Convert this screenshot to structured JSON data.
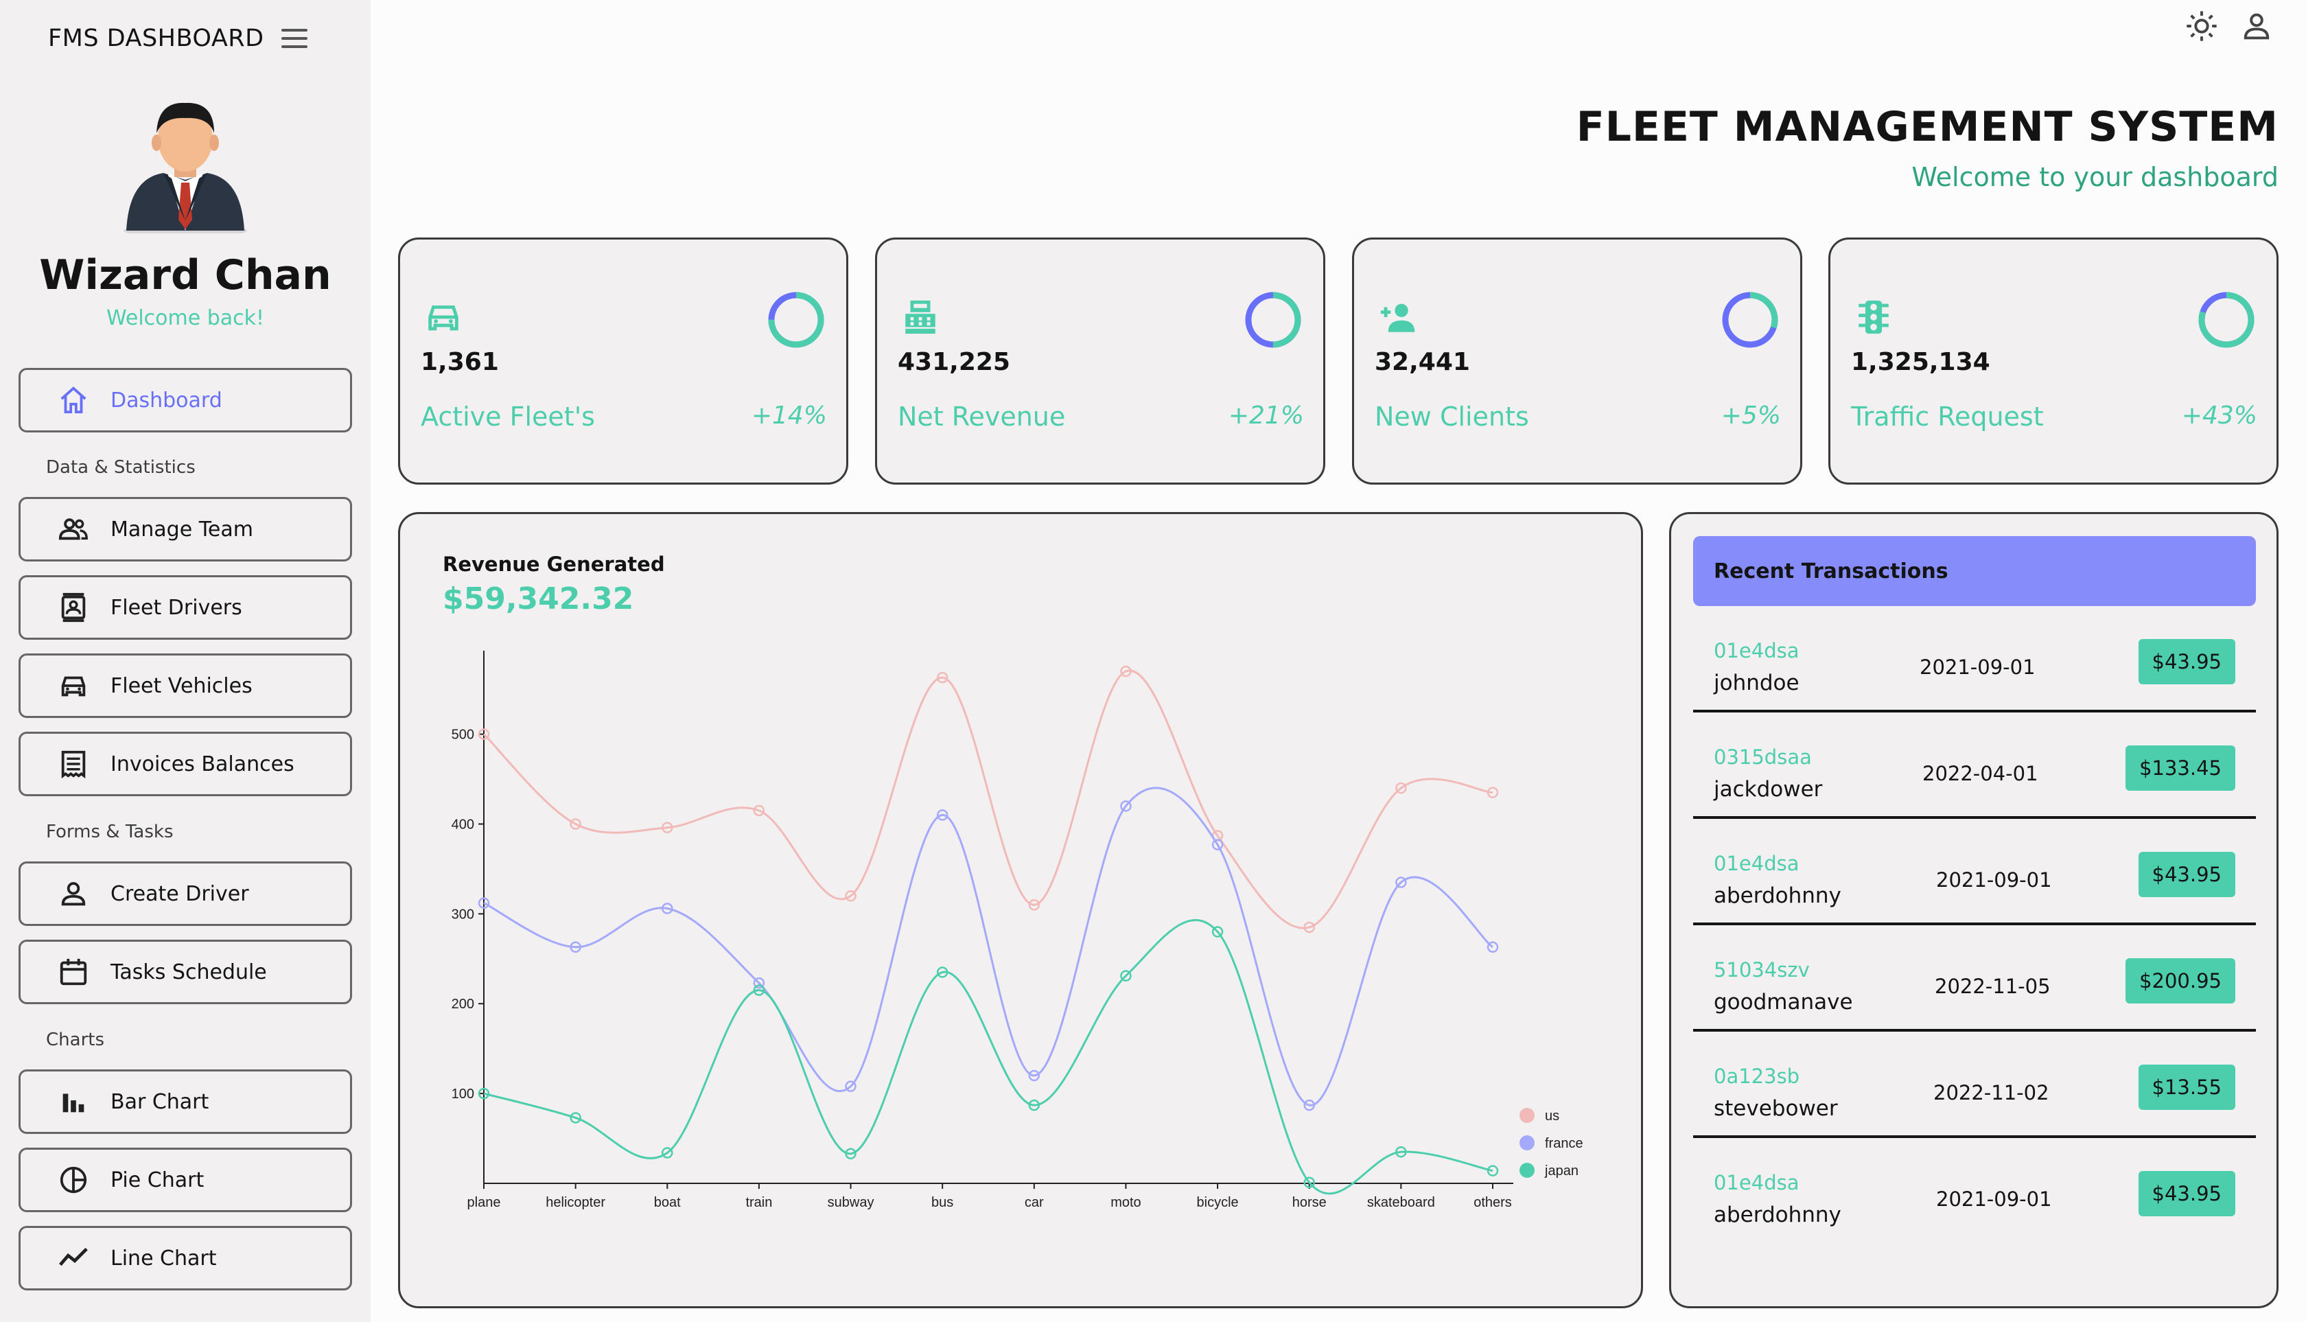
{
  "sidebar": {
    "brand": "FMS DASHBOARD",
    "user_name": "Wizard Chan",
    "user_subtitle": "Welcome back!",
    "dashboard_label": "Dashboard",
    "section_data": "Data & Statistics",
    "manage_team": "Manage Team",
    "fleet_drivers": "Fleet Drivers",
    "fleet_vehicles": "Fleet Vehicles",
    "invoices": "Invoices Balances",
    "section_forms": "Forms & Tasks",
    "create_driver": "Create Driver",
    "tasks_schedule": "Tasks Schedule",
    "section_charts": "Charts",
    "bar_chart": "Bar Chart",
    "pie_chart": "Pie Chart",
    "line_chart": "Line Chart"
  },
  "header": {
    "title": "FLEET MANAGEMENT SYSTEM",
    "subtitle": "Welcome to your dashboard",
    "icons": [
      "sun-icon",
      "user-icon"
    ]
  },
  "stats": [
    {
      "icon": "car-icon",
      "value": "1,361",
      "label": "Active Fleet's",
      "delta": "+14%",
      "progress": 0.75
    },
    {
      "icon": "cash-register-icon",
      "value": "431,225",
      "label": "Net Revenue",
      "delta": "+21%",
      "progress": 0.5
    },
    {
      "icon": "person-add-icon",
      "value": "32,441",
      "label": "New Clients",
      "delta": "+5%",
      "progress": 0.3
    },
    {
      "icon": "traffic-light-icon",
      "value": "1,325,134",
      "label": "Traffic Request",
      "delta": "+43%",
      "progress": 0.8
    }
  ],
  "revenue": {
    "title": "Revenue Generated",
    "amount": "$59,342.32"
  },
  "transactions": {
    "title": "Recent Transactions",
    "rows": [
      {
        "id": "01e4dsa",
        "user": "johndoe",
        "date": "2021-09-01",
        "cost": "$43.95"
      },
      {
        "id": "0315dsaa",
        "user": "jackdower",
        "date": "2022-04-01",
        "cost": "$133.45"
      },
      {
        "id": "01e4dsa",
        "user": "aberdohnny",
        "date": "2021-09-01",
        "cost": "$43.95"
      },
      {
        "id": "51034szv",
        "user": "goodmanave",
        "date": "2022-11-05",
        "cost": "$200.95"
      },
      {
        "id": "0a123sb",
        "user": "stevebower",
        "date": "2022-11-02",
        "cost": "$13.55"
      },
      {
        "id": "01e4dsa",
        "user": "aberdohnny",
        "date": "2021-09-01",
        "cost": "$43.95"
      }
    ]
  },
  "colors": {
    "accent_green": "#4cceac",
    "accent_blue": "#6870fa",
    "header_blue": "#868dfb",
    "series_us": "#f1b9b7",
    "series_france": "#a4a9fc",
    "series_japan": "#4cceac"
  },
  "chart_data": {
    "type": "line",
    "categories": [
      "plane",
      "helicopter",
      "boat",
      "train",
      "subway",
      "bus",
      "car",
      "moto",
      "bicycle",
      "horse",
      "skateboard",
      "others"
    ],
    "series": [
      {
        "name": "us",
        "values": [
          500,
          400,
          396,
          415,
          320,
          563,
          310,
          570,
          387,
          285,
          440,
          435
        ]
      },
      {
        "name": "france",
        "values": [
          312,
          263,
          306,
          223,
          108,
          410,
          120,
          420,
          377,
          87,
          335,
          263
        ]
      },
      {
        "name": "japan",
        "values": [
          100,
          73,
          34,
          215,
          33,
          235,
          87,
          231,
          280,
          1,
          35,
          14
        ]
      }
    ],
    "yticks": [
      100,
      200,
      300,
      400,
      500
    ],
    "ylim": [
      0,
      570
    ],
    "grid": false,
    "legend": "bottom-right"
  }
}
